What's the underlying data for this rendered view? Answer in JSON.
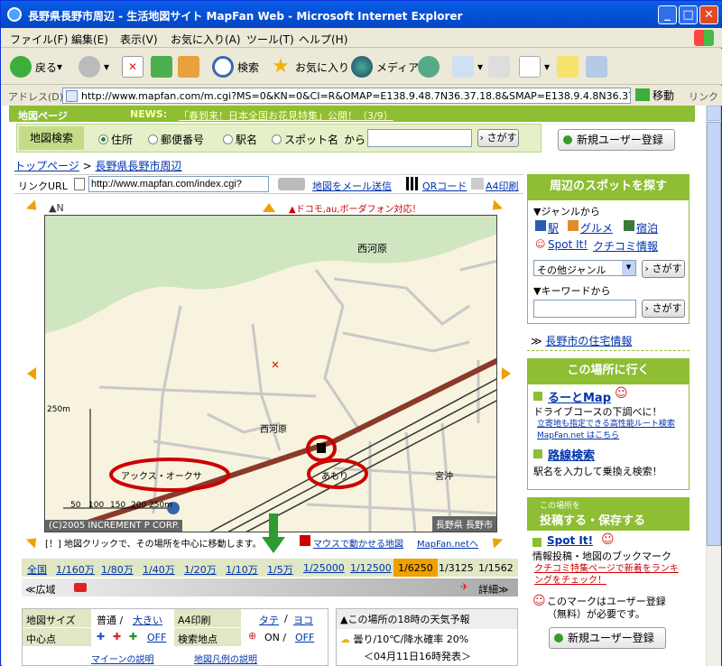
{
  "window": {
    "title": "長野県長野市周辺 - 生活地図サイト MapFan Web - Microsoft Internet Explorer",
    "min": "_",
    "max": "□",
    "close": "✕"
  },
  "menu": [
    "ファイル(F)",
    "編集(E)",
    "表示(V)",
    "お気に入り(A)",
    "ツール(T)",
    "ヘルプ(H)"
  ],
  "toolbar": {
    "back": "戻る",
    "search": "検索",
    "favorites": "お気に入り",
    "media": "メディア"
  },
  "address": {
    "label": "アドレス(D)",
    "url": "http://www.mapfan.com/m.cgi?MS=0&KN=0&CI=R&OMAP=E138.9.48.7N36.37.18.8&SMAP=E138.9.4.8N36.37.18.8&SP=1&",
    "go": "移動",
    "links": "リンク"
  },
  "topbar": {
    "label": "地図ページ",
    "news": "NEWS:",
    "news_link": "「春到来！日本全国お花見特集」公開！（3/9）"
  },
  "search": {
    "label": "地図検索",
    "options": [
      "住所",
      "郵便番号",
      "駅名",
      "スポット名"
    ],
    "kara": "から",
    "button": "さがす",
    "register": "新規ユーザー登録"
  },
  "breadcrumb": {
    "top": "トップページ",
    "sep": ">",
    "current": "長野県長野市周辺"
  },
  "linkurl": {
    "label": "リンクURL",
    "value": "http://www.mapfan.com/index.cgi?",
    "mail": "地図をメール送信",
    "qr": "QRコード",
    "print": "A4印刷"
  },
  "map": {
    "north": "▲N",
    "mobile": "▲ドコモ,au,ボーダフォン対応！",
    "place1": "西河原",
    "place2": "西河原",
    "station": "アックス・オークサ",
    "shop": "あもり",
    "area": "宮沖",
    "scale_label": "250m",
    "scale_ticks": [
      "50",
      "100",
      "150",
      "200",
      "250m"
    ],
    "copyright": "(C)2005 INCREMENT P CORP.",
    "city": "長野県 長野市",
    "hint": "[！] 地図クリックで、その場所を中心に移動します。",
    "drag": "マウスで動かせる地図",
    "drag_link": "MapFan.netへ"
  },
  "scales": [
    "全国",
    "1/160万",
    "1/80万",
    "1/40万",
    "1/20万",
    "1/10万",
    "1/5万",
    "1/25000",
    "1/12500",
    "1/6250",
    "1/3125",
    "1/1562"
  ],
  "scale_active": "1/6250",
  "zoom": {
    "wide": "≪広域",
    "detail": "詳細≫"
  },
  "settings": {
    "size": "地図サイズ",
    "normal": "普通 /",
    "large": "大きい",
    "a4": "A4印刷",
    "tate": "タテ",
    "sep": "/",
    "yoko": "ヨコ",
    "center": "中心点",
    "off": "OFF",
    "search_pt": "検索地点",
    "on": "ON /",
    "off2": "OFF",
    "more1": "マイーンの説明",
    "more2": "地図凡例の説明"
  },
  "weather": {
    "title": "▲この場所の18時の天気予報",
    "text": "曇り/10℃/降水確率 20%",
    "date": "＜04月11日16時発表＞"
  },
  "side": {
    "spot_header": "周辺のスポットを探す",
    "genre": "▼ジャンルから",
    "eki": "駅",
    "gourmet": "グルメ",
    "hotel": "宿泊",
    "spotit": "Spot It!",
    "kuchikomi": "クチコミ情報",
    "other_genre": "その他ジャンル",
    "sagasu": "さがす",
    "keyword": "▼キーワードから",
    "housing": "長野市の住宅情報",
    "go_header": "この場所に行く",
    "route": "るーとMap",
    "route_desc": "ドライブコースの下調べに！",
    "route_link": "立寄地も指定できる高性能ルート検索 MapFan.net はこちら",
    "transit": "路線検索",
    "transit_desc": "駅名を入力して乗換え検索！",
    "post_small": "この場所を",
    "post_header": "投稿する・保存する",
    "spot2": "Spot It!",
    "spot2_desc": "情報投稿・地図のブックマーク",
    "feature": "クチコミ特集ページで新着をランキングをチェック！",
    "note": "このマークはユーザー登録（無料）が必要です。",
    "register": "新規ユーザー登録"
  },
  "colors": {
    "green": "#8dbe34",
    "link": "#0033aa",
    "red": "#cc0000"
  }
}
